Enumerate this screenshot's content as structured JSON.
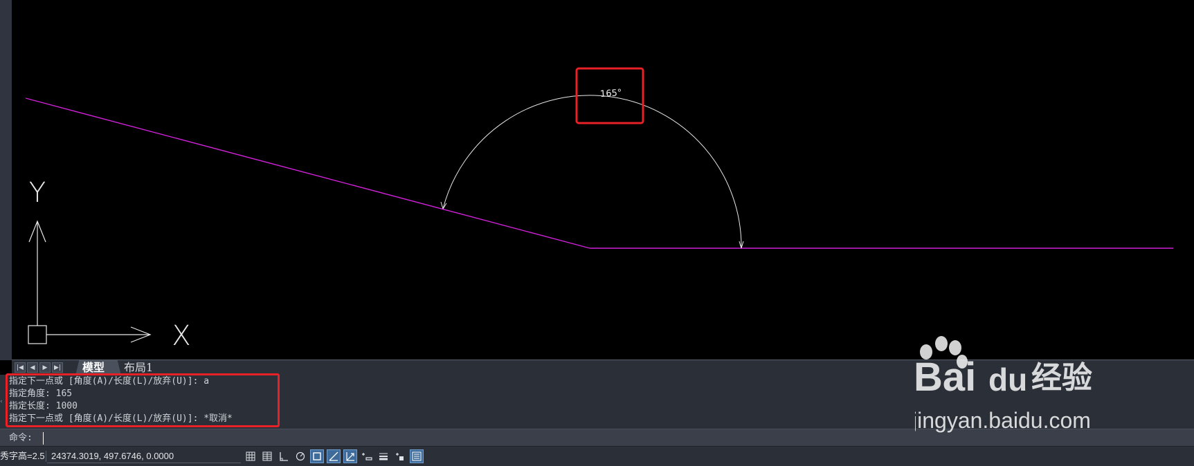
{
  "drawing": {
    "angle_dimension_text": "165°",
    "axis_x_label": "X",
    "axis_y_label": "Y"
  },
  "layout_tabs": {
    "nav_icons": [
      "first-icon",
      "prev-icon",
      "next-icon",
      "last-icon"
    ],
    "tabs": [
      {
        "label": "模型",
        "active": true
      },
      {
        "label": "布局1",
        "active": false
      }
    ]
  },
  "command_history": [
    "指定下一点或 [角度(A)/长度(L)/放弃(U)]: a",
    "指定角度: 165",
    "指定长度: 1000",
    "指定下一点或 [角度(A)/长度(L)/放弃(U)]: *取消*"
  ],
  "command_input": {
    "prompt": "命令:",
    "value": ""
  },
  "status_bar": {
    "text_height": "秀字高=2.5",
    "coordinates": "24374.3019, 497.6746, 0.0000",
    "icons": [
      "grid-display-icon",
      "snap-grid-icon",
      "ortho-icon",
      "polar-icon",
      "osnap-icon",
      "otrack-icon",
      "dynamic-ucs-icon",
      "dynamic-input-icon",
      "lineweight-icon",
      "transparency-icon",
      "quick-properties-icon"
    ]
  },
  "watermark": {
    "brand": "Bai",
    "brand2": "du",
    "suffix": "经验",
    "url": "jingyan.baidu.com"
  },
  "colors": {
    "polyline": "#d020d8",
    "highlight": "#e82127",
    "background": "#000000",
    "panel": "#2b2f38"
  }
}
